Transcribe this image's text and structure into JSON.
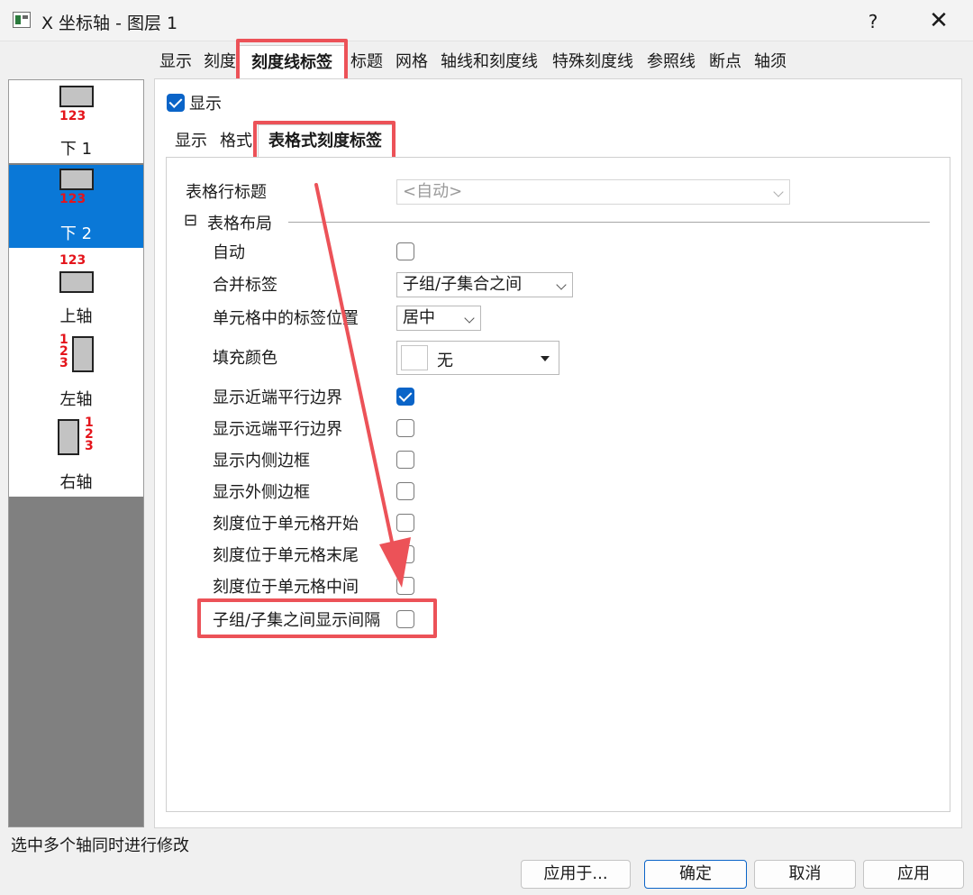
{
  "window": {
    "title": "X 坐标轴 - 图层 1",
    "help_label": "?",
    "close_label": "✕"
  },
  "top_tabs": [
    "显示",
    "刻度",
    "刻度线标签",
    "标题",
    "网格",
    "轴线和刻度线",
    "特殊刻度线",
    "参照线",
    "断点",
    "轴须"
  ],
  "axes": [
    {
      "label": "下 1",
      "numbers": "123"
    },
    {
      "label": "下 2",
      "numbers": "123"
    },
    {
      "label": "上轴",
      "numbers": "123"
    },
    {
      "label": "左轴",
      "numbers": "123"
    },
    {
      "label": "右轴",
      "numbers": "123"
    }
  ],
  "show_checkbox": {
    "label": "显示",
    "checked": true
  },
  "sub_tabs": [
    "显示",
    "格式",
    "表格式刻度标签"
  ],
  "form": {
    "table_row_title": {
      "label": "表格行标题",
      "value": "<自动>"
    },
    "section": {
      "toggle": "⊟",
      "label": "表格布局"
    },
    "auto": {
      "label": "自动",
      "checked": false
    },
    "merge": {
      "label": "合并标签",
      "value": "子组/子集合之间"
    },
    "position": {
      "label": "单元格中的标签位置",
      "value": "居中"
    },
    "fill": {
      "label": "填充颜色",
      "value": "无"
    },
    "options": [
      {
        "label": "显示近端平行边界",
        "checked": true
      },
      {
        "label": "显示远端平行边界",
        "checked": false
      },
      {
        "label": "显示内侧边框",
        "checked": false
      },
      {
        "label": "显示外侧边框",
        "checked": false
      },
      {
        "label": "刻度位于单元格开始",
        "checked": false
      },
      {
        "label": "刻度位于单元格末尾",
        "checked": false
      },
      {
        "label": "刻度位于单元格中间",
        "checked": false
      },
      {
        "label": "子组/子集之间显示间隔",
        "checked": false
      }
    ]
  },
  "status": "选中多个轴同时进行修改",
  "buttons": {
    "apply_to": "应用于...",
    "ok": "确定",
    "cancel": "取消",
    "apply": "应用"
  },
  "colors": {
    "accent": "#0a64c8",
    "selected_axis": "#0a78d7",
    "highlight": "#ec5258",
    "axis_numbers": "#e4141b"
  }
}
